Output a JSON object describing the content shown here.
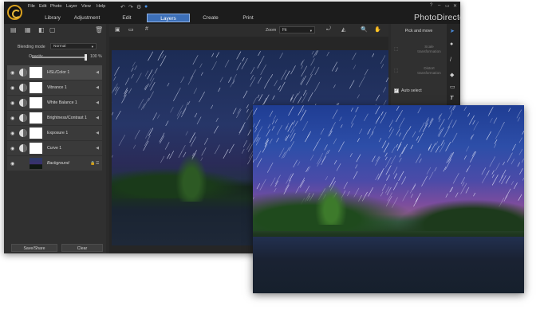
{
  "app": {
    "title": "PhotoDirector",
    "menu": [
      "File",
      "Edit",
      "Photo",
      "Layer",
      "View",
      "Help"
    ],
    "tabs": [
      {
        "label": "Library",
        "active": false
      },
      {
        "label": "Adjustment",
        "active": false
      },
      {
        "label": "Edit",
        "active": false
      },
      {
        "label": "Layers",
        "active": true
      },
      {
        "label": "Create",
        "active": false
      },
      {
        "label": "Print",
        "active": false
      }
    ],
    "window_controls": [
      "?",
      "–",
      "▭",
      "✕"
    ]
  },
  "layers_panel": {
    "blending_mode_label": "Blending mode",
    "blending_mode_value": "Normal",
    "opacity_label": "Opacity",
    "opacity_value": "100 %",
    "opacity_fraction": 1.0,
    "layers": [
      {
        "name": "HSL/Color 1",
        "selected": true
      },
      {
        "name": "Vibrance 1",
        "selected": false
      },
      {
        "name": "White Balance 1",
        "selected": false
      },
      {
        "name": "Brightness/Contrast 1",
        "selected": false
      },
      {
        "name": "Exposure 1",
        "selected": false
      },
      {
        "name": "Curve 1",
        "selected": false
      }
    ],
    "background_layer": "Background",
    "save_share_label": "Save/Share",
    "clear_label": "Clear"
  },
  "canvas": {
    "zoom_label": "Zoom",
    "zoom_value": "Fit"
  },
  "tool_panel": {
    "title": "Pick and move",
    "scale_transformation": "Scale transformation",
    "distort_transformation": "Distort transformation",
    "auto_select_label": "Auto select",
    "auto_select_checked": true
  },
  "colors": {
    "accent": "#3c6fb8",
    "panel": "#303030",
    "titlebar": "#1c1c1c"
  }
}
